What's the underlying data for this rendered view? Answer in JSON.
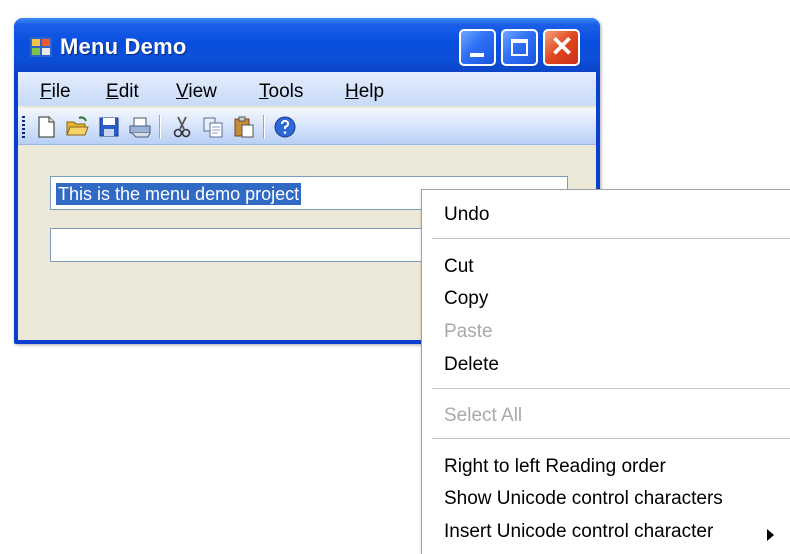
{
  "window": {
    "title": "Menu Demo",
    "close_glyph": "✕",
    "menu": [
      {
        "first": "F",
        "rest": "ile"
      },
      {
        "first": "E",
        "rest": "dit"
      },
      {
        "first": "V",
        "rest": "iew"
      },
      {
        "first": "T",
        "rest": "ools"
      },
      {
        "first": "H",
        "rest": "elp"
      }
    ],
    "toolbar_icons": [
      "new-file-icon",
      "open-folder-icon",
      "save-icon",
      "print-icon",
      "cut-icon",
      "copy-icon",
      "paste-icon",
      "help-icon"
    ],
    "textbox1": {
      "value": "This is the menu demo project"
    },
    "textbox2": {
      "value": ""
    }
  },
  "context_menu": {
    "items": [
      {
        "label": "Undo",
        "enabled": true
      },
      {
        "label": "Cut",
        "enabled": true
      },
      {
        "label": "Copy",
        "enabled": true
      },
      {
        "label": "Paste",
        "enabled": false
      },
      {
        "label": "Delete",
        "enabled": true
      },
      {
        "label": "Select All",
        "enabled": false
      },
      {
        "label": "Right to left Reading order",
        "enabled": true
      },
      {
        "label": "Show Unicode control characters",
        "enabled": true
      },
      {
        "label": "Insert Unicode control character",
        "enabled": true,
        "submenu": true
      }
    ]
  },
  "colors": {
    "titlebar": "#0a4ee0",
    "selection": "#316ac5",
    "client": "#ece9d8",
    "disabled_text": "#a9a9a9"
  }
}
